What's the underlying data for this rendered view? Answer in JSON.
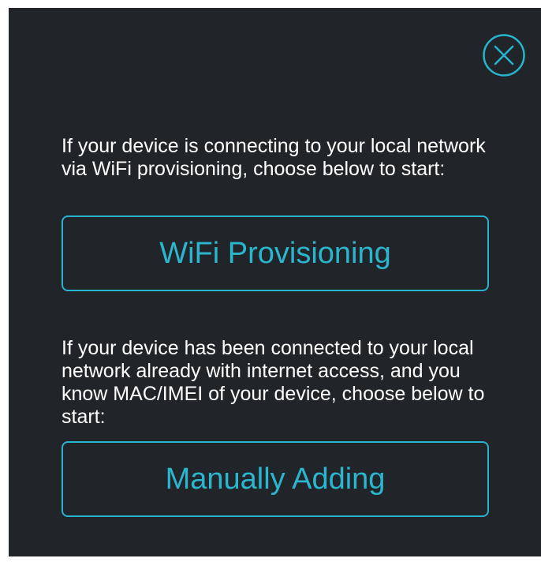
{
  "colors": {
    "background": "#212529",
    "accent": "#27b4cc",
    "text": "#ffffff"
  },
  "dialog": {
    "close_icon": "close-circle-icon",
    "wifi_section": {
      "prompt": "If your device is connecting to your local network via WiFi provisioning, choose below to start:",
      "button_label": "WiFi Provisioning"
    },
    "manual_section": {
      "prompt": "If your device has been connected to your local network already with internet access, and you know MAC/IMEI of your device, choose below to start:",
      "button_label": "Manually Adding"
    }
  }
}
